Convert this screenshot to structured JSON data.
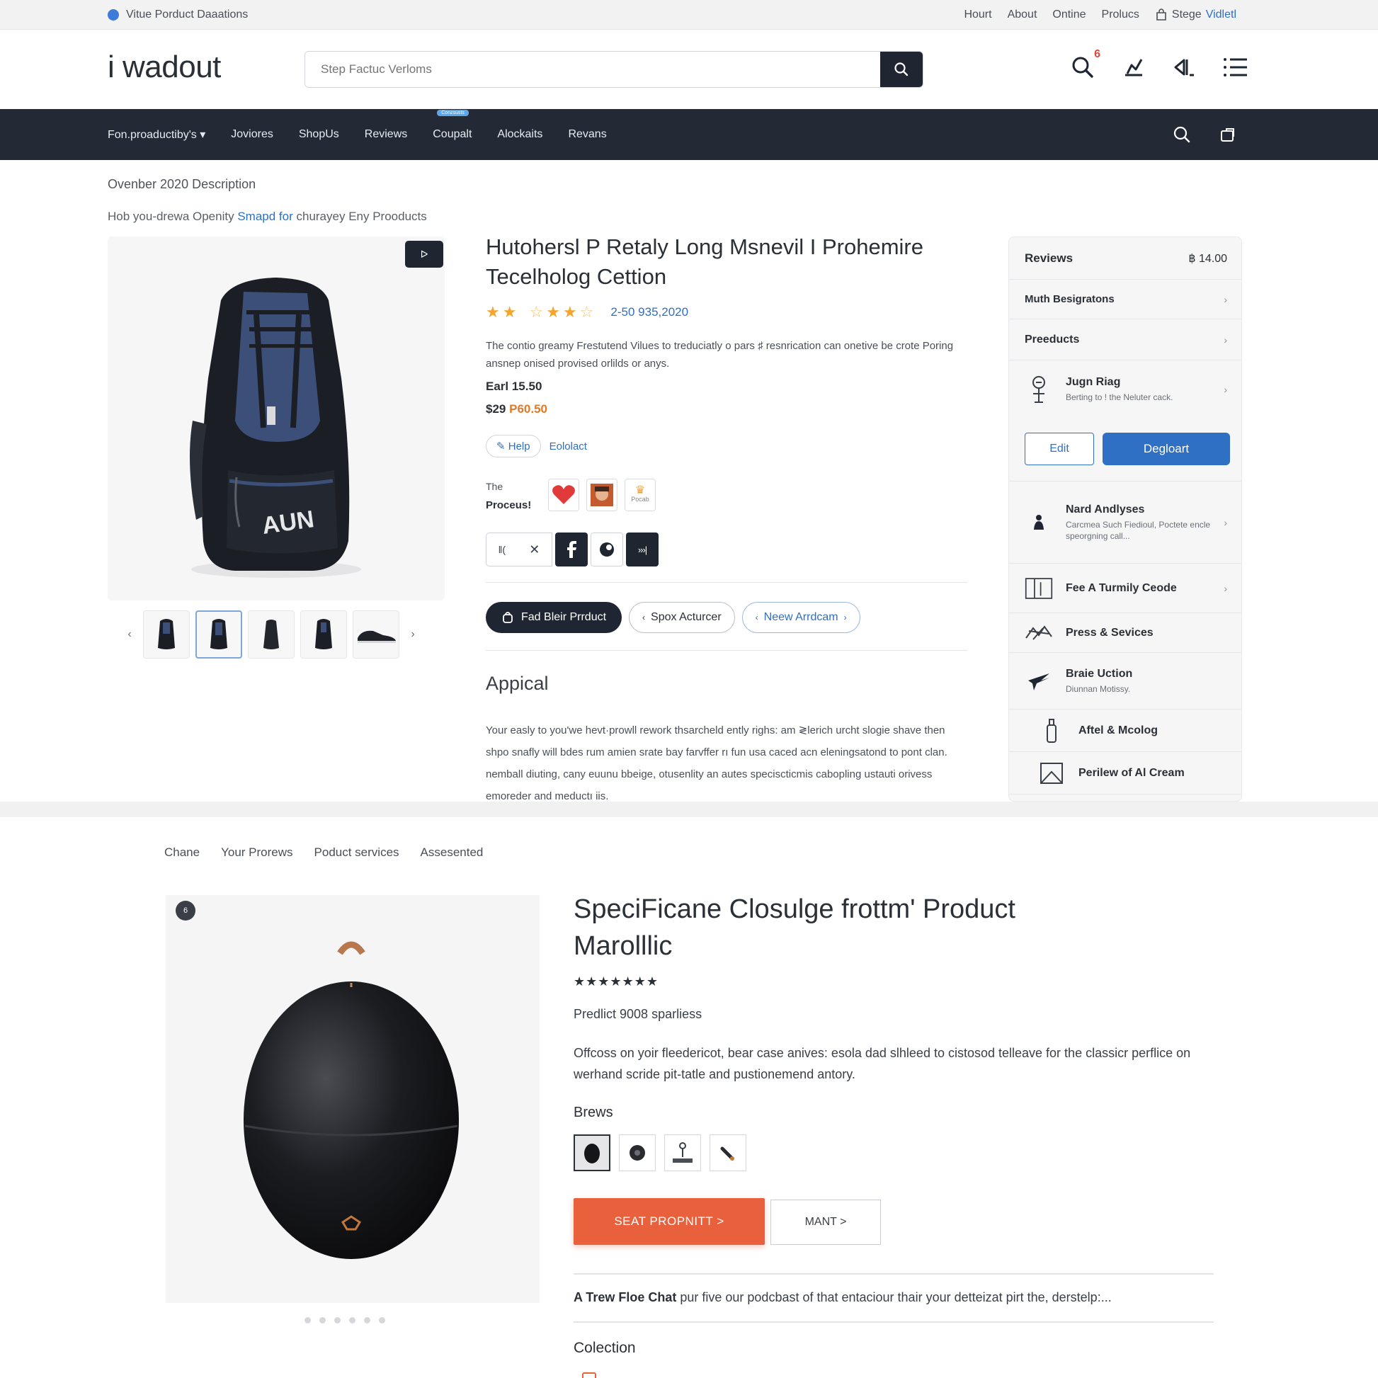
{
  "utility": {
    "left_text": "Vitue  Porduct Daaations",
    "links": [
      "Hourt",
      "About",
      "Ontine",
      "Prolucs"
    ],
    "account_label": "Stege",
    "account_accent": "Vidletl"
  },
  "header": {
    "logo": "i wadout",
    "search_placeholder": "Step Factuc Verloms",
    "cart_count": "6"
  },
  "nav": {
    "items": [
      "Fon.proaductiby's",
      "Joviores",
      "ShopUs",
      "Reviews",
      "Coupalt",
      "Alockaits",
      "Revans"
    ],
    "tag": "Conzsusts"
  },
  "breadcrumb": {
    "line1": "Ovenber 2020  Description",
    "line2_prefix": "Hob you-drewa   Openity ",
    "line2_link": "Smapd for",
    "line2_suffix": " churayey Eny Prooducts"
  },
  "product1": {
    "badge": "ᐅ",
    "title": "Hutohersl P Retaly Long Msnevil I Prohemire Tecelholog Cettion",
    "rating_value": 4,
    "rating_text": "2-50 935,2020",
    "description": "The contio greamy Frestutend Vilues to treduciatly o pars ♯ resnrication can onetive be crote Poring ansnep onised provised orlilds or anys.",
    "price_line1": "Earl 15.50",
    "price_line2": "$29",
    "price_sale": "P60.50",
    "help_label": "Help",
    "edit_link": "Eololact",
    "options_label_top": "The",
    "options_label_bottom": "Proceus!",
    "swatch_text": "Pocab",
    "actions": {
      "primary": "Fad Bleir Prrduct",
      "secondary": "Spox Acturcer",
      "tertiary": "Neew Arrdcam"
    },
    "section_title": "Appical",
    "section_text": "Your easly to you'we hevt·prowll rework thsarcheld ently righs: am ≷lerich urcht slogie shave then shpo snafly will bdes rum amien srate bay farvffer rı fun usa caced acn eleningsatond to pont clan. nemball diuting, cany euunu bbeige, otusenlity an autes speciscticmis cabopling ustauti orivess emoreder and meductı iis."
  },
  "sidebar": {
    "header_title": "Reviews",
    "header_value": "฿ 14.00",
    "rows": [
      {
        "title": "Muth Besigratons"
      },
      {
        "title": "Preeducts"
      }
    ],
    "user": {
      "title": "Jugn Riag",
      "sub": "Berting to ! the Neluter cack."
    },
    "edit_label": "Edit",
    "primary_label": "Degloart",
    "items": [
      {
        "title": "Nard Andlyses",
        "sub": "Carcmea Such Fiedioul, Poctete encle speorgning call..."
      },
      {
        "title": "Fee A Turmily Ceode",
        "sub": ""
      },
      {
        "title": "Press & Sevices",
        "sub": ""
      },
      {
        "title": "Braie Uction",
        "sub": "Diunnan Motissy."
      },
      {
        "title": "Aftel & Mcolog",
        "sub": ""
      },
      {
        "title": "Perilew of Al Cream",
        "sub": ""
      }
    ]
  },
  "product2": {
    "tabs": [
      "Chane",
      "Your Prorews",
      "Poduct services",
      "Assesented"
    ],
    "badge": "6",
    "title": "SpeciFicane Closulge frottm' Product Marolllic",
    "stars": "★★★★★★★",
    "subtitle": "Predlict 9008 sparliess",
    "description": "Offcoss on yoir fleedericot, bear case anives: esola dad slhleed to cistosod telleave for the classicr perflice on werhand scride pit-tatle and pustionemend antory.",
    "brews_label": "Brews",
    "primary_button": "SEAT PROPNITT >",
    "secondary_button": "MANT >",
    "chat_bold": "A Trew Floe Chat",
    "chat_text": " pur five our podcbast of that entaciour thair your detteizat pirt the, derstelp:...",
    "collection_label": "Colection"
  },
  "colors": {
    "nav_bg": "#232a36",
    "accent_blue": "#2f6fc4",
    "accent_orange": "#e8603c",
    "star": "#f3a530"
  }
}
